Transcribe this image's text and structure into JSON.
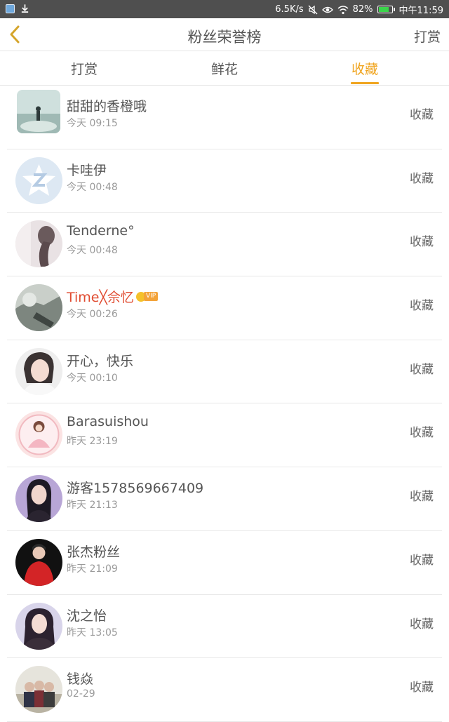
{
  "status_bar": {
    "speed": "6.5K/s",
    "battery": "82%",
    "clock": "中午11:59",
    "icons": [
      "app-icon",
      "download-icon",
      "mute-icon",
      "eye-icon",
      "wifi-icon",
      "battery-icon"
    ]
  },
  "header": {
    "title": "粉丝荣誉榜",
    "action": "打赏",
    "back_icon": "chevron-left-icon"
  },
  "tabs": [
    {
      "label": "打赏",
      "active": false
    },
    {
      "label": "鲜花",
      "active": false
    },
    {
      "label": "收藏",
      "active": true
    }
  ],
  "colors": {
    "accent": "#f0a520",
    "vip_name": "#e04b30",
    "status_bar_bg": "#4f4f4f"
  },
  "fans": [
    {
      "name": "甜甜的香橙哦",
      "time": "今天 09:15",
      "action": "收藏"
    },
    {
      "name": "卡哇伊",
      "time": "今天 00:48",
      "action": "收藏"
    },
    {
      "name": "Tenderne°",
      "time": "今天 00:48",
      "action": "收藏"
    },
    {
      "name": "Time╳佘忆",
      "time": "今天 00:26",
      "action": "收藏",
      "vip": true,
      "vip_label": "VIP"
    },
    {
      "name": "开心，快乐",
      "time": "今天 00:10",
      "action": "收藏"
    },
    {
      "name": "Barasuishou",
      "time": "昨天 23:19",
      "action": "收藏"
    },
    {
      "name": "游客1578569667409",
      "time": "昨天 21:13",
      "action": "收藏"
    },
    {
      "name": "张杰粉丝",
      "time": "昨天 21:09",
      "action": "收藏"
    },
    {
      "name": "沈之怡",
      "time": "昨天 13:05",
      "action": "收藏"
    },
    {
      "name": "钱焱",
      "time": "02-29",
      "action": "收藏"
    }
  ]
}
